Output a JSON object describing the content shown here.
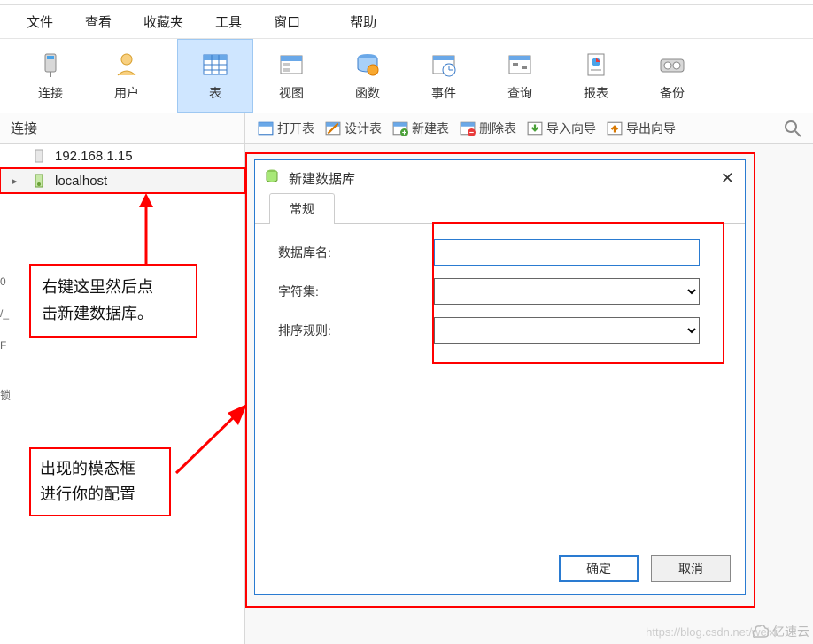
{
  "menu": {
    "file": "文件",
    "view": "查看",
    "favorites": "收藏夹",
    "tools": "工具",
    "window": "窗口",
    "help": "帮助"
  },
  "toolbar": {
    "connection": "连接",
    "user": "用户",
    "table": "表",
    "view": "视图",
    "function": "函数",
    "event": "事件",
    "query": "查询",
    "report": "报表",
    "backup": "备份"
  },
  "subbar": {
    "conn_label": "连接",
    "open_table": "打开表",
    "design_table": "设计表",
    "new_table": "新建表",
    "delete_table": "删除表",
    "import_wizard": "导入向导",
    "export_wizard": "导出向导"
  },
  "sidebar": {
    "items": [
      {
        "label": "192.168.1.15"
      },
      {
        "label": "localhost"
      }
    ]
  },
  "annotations": {
    "tip1_line1": "右键这里然后点",
    "tip1_line2": "击新建数据库。",
    "tip2_line1": "出现的模态框",
    "tip2_line2": "进行你的配置"
  },
  "modal": {
    "title": "新建数据库",
    "tab_general": "常规",
    "label_dbname": "数据库名:",
    "label_charset": "字符集:",
    "label_collation": "排序规则:",
    "btn_ok": "确定",
    "btn_cancel": "取消",
    "dbname_value": "",
    "charset_value": "",
    "collation_value": ""
  },
  "watermark": "https://blog.csdn.net/weixi",
  "logo_text": "亿速云",
  "left_strip": {
    "a": "0",
    "b": "/_",
    "c": "F",
    "d": "锁"
  }
}
